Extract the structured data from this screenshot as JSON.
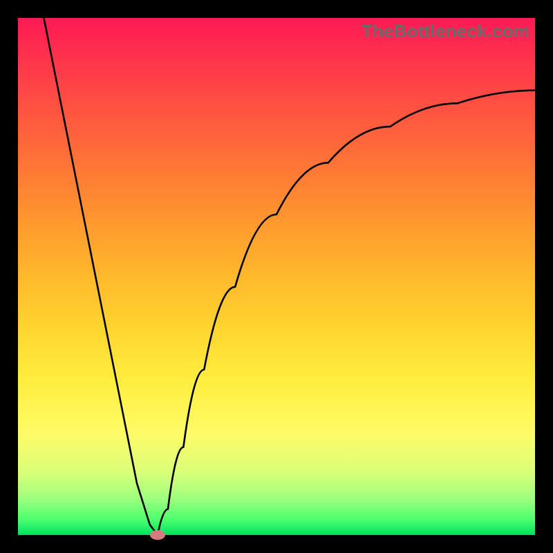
{
  "watermark": "TheBottleneck.com",
  "chart_data": {
    "type": "line",
    "title": "",
    "xlabel": "",
    "ylabel": "",
    "xlim": [
      0,
      100
    ],
    "ylim": [
      0,
      100
    ],
    "grid": false,
    "legend": false,
    "series": [
      {
        "name": "left-branch",
        "x": [
          5.0,
          8.0,
          12.0,
          16.0,
          20.0,
          23.0,
          25.5,
          27.0
        ],
        "values": [
          100.0,
          85.0,
          65.0,
          45.0,
          25.0,
          10.0,
          2.0,
          0.0
        ]
      },
      {
        "name": "right-branch",
        "x": [
          27.0,
          29.0,
          32.0,
          36.0,
          42.0,
          50.0,
          60.0,
          72.0,
          85.0,
          100.0
        ],
        "values": [
          0.0,
          5.0,
          17.0,
          32.0,
          48.0,
          62.0,
          72.0,
          79.0,
          83.5,
          86.0
        ]
      }
    ],
    "marker": {
      "name": "bottleneck-point",
      "x": 27.0,
      "y": 0.0,
      "color": "#d57b7e"
    },
    "background_gradient": {
      "top": "#ff1a54",
      "bottom": "#00e060",
      "stops": [
        "red",
        "orange",
        "yellow",
        "green"
      ]
    }
  }
}
